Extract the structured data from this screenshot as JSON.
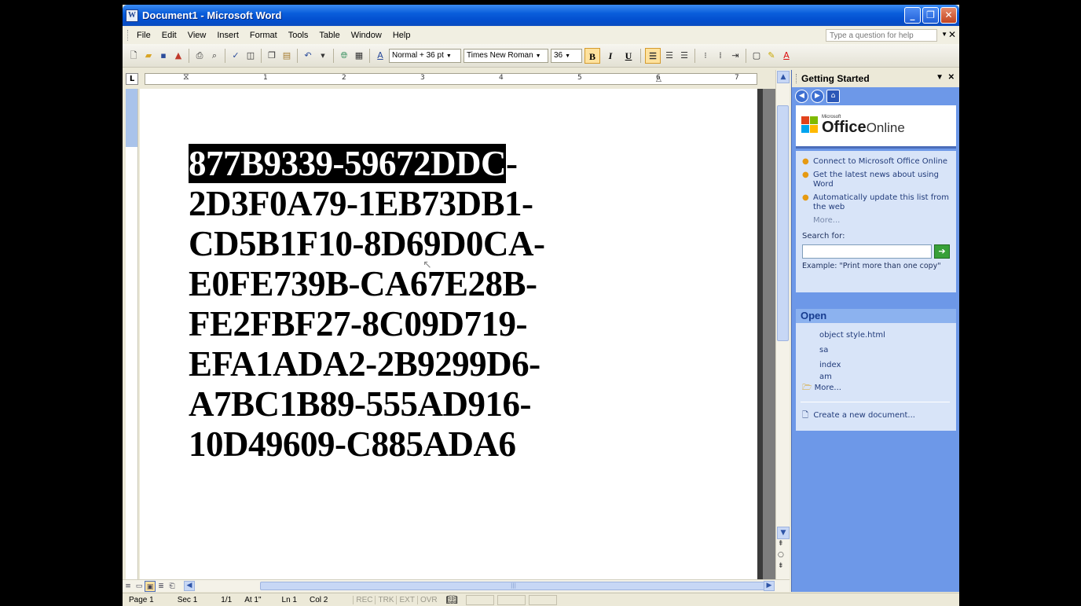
{
  "window": {
    "title": "Document1 - Microsoft Word",
    "minimize": "_",
    "maximize": "❐",
    "close": "✕"
  },
  "menu": {
    "items": [
      "File",
      "Edit",
      "View",
      "Insert",
      "Format",
      "Tools",
      "Table",
      "Window",
      "Help"
    ],
    "help_placeholder": "Type a question for help"
  },
  "formatting": {
    "style": "Normal + 36 pt",
    "font": "Times New Roman",
    "size": "36",
    "bold": "B",
    "italic": "I",
    "underline": "U"
  },
  "ruler": {
    "numbers": [
      "1",
      "2",
      "3",
      "4",
      "5",
      "6",
      "7"
    ]
  },
  "document": {
    "lines": [
      "877B9339-59672DDC-",
      "2D3F0A79-1EB73DB1-",
      "CD5B1F10-8D69D0CA-",
      "E0FE739B-CA67E28B-",
      "FE2FBF27-8C09D719-",
      "EFA1ADA2-2B9299D6-",
      "A7BC1B89-555AD916-",
      "10D49609-C885ADA6"
    ],
    "selected_text": "877B9339-59672DDC",
    "first_line_rest": "-"
  },
  "task_pane": {
    "title": "Getting Started",
    "office_small": "Microsoft",
    "office_big": "Office",
    "office_online": "Online",
    "links": [
      "Connect to Microsoft Office Online",
      "Get the latest news about using Word",
      "Automatically update this list from the web"
    ],
    "more": "More...",
    "search_label": "Search for:",
    "search_value": "",
    "example": "Example:  \"Print more than one copy\"",
    "open_heading": "Open",
    "recent_files": [
      "object style.html",
      "sa",
      "index",
      "am"
    ],
    "open_more": "More...",
    "create_new": "Create a new document..."
  },
  "status": {
    "page": "Page 1",
    "sec": "Sec 1",
    "pages": "1/1",
    "at": "At 1\"",
    "ln": "Ln 1",
    "col": "Col 2",
    "rec": "REC",
    "trk": "TRK",
    "ext": "EXT",
    "ovr": "OVR"
  },
  "icons": [
    "word-app-icon",
    "new-icon",
    "open-icon",
    "save-icon",
    "permission-icon",
    "print-icon",
    "print-preview-icon",
    "spelling-icon",
    "research-icon",
    "copy-icon",
    "paste-icon",
    "undo-icon",
    "hyperlink-icon",
    "table-icon",
    "align-left-icon",
    "align-center-icon",
    "align-right-icon",
    "numbering-icon",
    "bullets-icon",
    "indent-icon",
    "border-icon",
    "highlight-icon",
    "font-color-icon",
    "back-icon",
    "forward-icon",
    "home-icon",
    "go-arrow-icon",
    "folder-icon",
    "new-document-icon"
  ],
  "colors": {
    "title_bar": "#0A5EDB",
    "task_pane": "#6D98E8",
    "selection_bg": "#000000",
    "accent_bullet": "#E69A12"
  }
}
